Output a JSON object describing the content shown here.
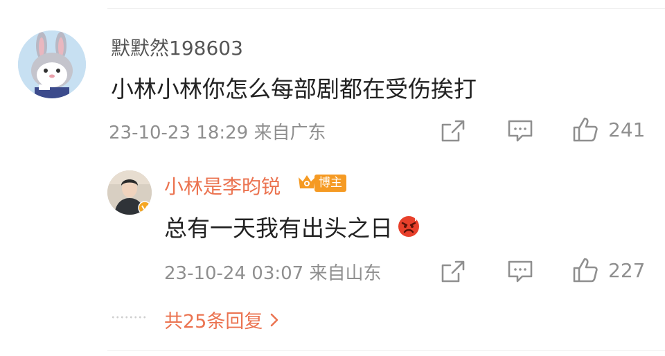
{
  "comment": {
    "username": "默默然198603",
    "text": "小林小林你怎么每部剧都在受伤挨打",
    "meta": "23-10-23 18:29  来自广东",
    "likes": "241"
  },
  "reply": {
    "username": "小林是李昀锐",
    "badge_label": "博主",
    "text": "总有一天我有出头之日",
    "emoji": "angry-face",
    "meta": "23-10-24 03:07  来自山东",
    "likes": "227"
  },
  "more_replies": {
    "label": "共25条回复"
  },
  "colors": {
    "accent": "#eb7350",
    "badge": "#f59a23",
    "secondary_text": "#8f8f8f"
  }
}
